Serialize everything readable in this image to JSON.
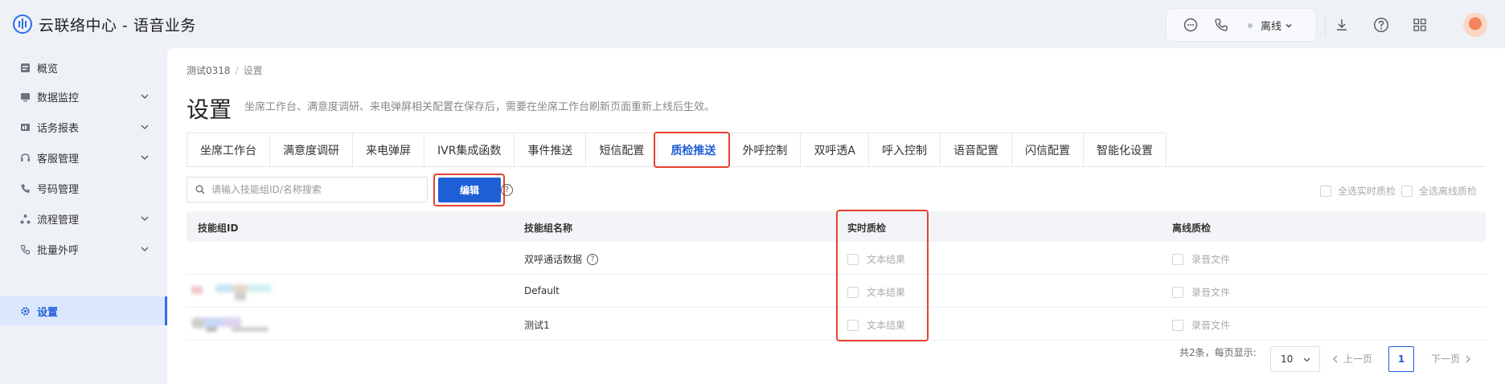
{
  "header": {
    "app_title": "云联络中心 - 语音业务",
    "status_label": "离线",
    "icons": [
      "chat-icon",
      "phone-icon",
      "download-icon",
      "help-icon",
      "grid-icon"
    ]
  },
  "sidebar": {
    "items": [
      {
        "label": "概览",
        "icon": "overview-icon",
        "expandable": false
      },
      {
        "label": "数据监控",
        "icon": "monitor-icon",
        "expandable": true
      },
      {
        "label": "话务报表",
        "icon": "report-icon",
        "expandable": true
      },
      {
        "label": "客服管理",
        "icon": "headset-icon",
        "expandable": true
      },
      {
        "label": "号码管理",
        "icon": "phone-icon",
        "expandable": false
      },
      {
        "label": "流程管理",
        "icon": "flow-icon",
        "expandable": true
      },
      {
        "label": "批量外呼",
        "icon": "phone-icon",
        "expandable": true
      },
      {
        "label": "设置",
        "icon": "gear-icon",
        "expandable": false,
        "active": true
      }
    ]
  },
  "breadcrumb": {
    "parent": "测试0318",
    "separator": "/",
    "current": "设置"
  },
  "page": {
    "title": "设置",
    "description": "坐席工作台、满意度调研、来电弹屏相关配置在保存后，需要在坐席工作台刷新页面重新上线后生效。"
  },
  "tabs": [
    "坐席工作台",
    "满意度调研",
    "来电弹屏",
    "IVR集成函数",
    "事件推送",
    "短信配置",
    "质检推送",
    "外呼控制",
    "双呼透A",
    "呼入控制",
    "语音配置",
    "闪信配置",
    "智能化设置"
  ],
  "active_tab": "质检推送",
  "toolbar": {
    "search_placeholder": "请输入技能组ID/名称搜索",
    "edit_label": "编辑",
    "help_glyph": "?",
    "select_all_realtime": "全选实时质检",
    "select_all_offline": "全选离线质检"
  },
  "table": {
    "columns": [
      "技能组ID",
      "技能组名称",
      "实时质检",
      "离线质检"
    ],
    "rows": [
      {
        "id": "",
        "id_blurred": false,
        "name": "双呼通话数据",
        "name_help": true,
        "realtime": "文本结果",
        "offline": "录音文件"
      },
      {
        "id": "",
        "id_blurred": true,
        "name": "Default",
        "name_help": false,
        "realtime": "文本结果",
        "offline": "录音文件"
      },
      {
        "id": "",
        "id_blurred": true,
        "name": "测试1",
        "name_help": false,
        "realtime": "文本结果",
        "offline": "录音文件"
      }
    ]
  },
  "pagination": {
    "total_text": "共2条，每页显示:",
    "page_size": "10",
    "prev_label": "上一页",
    "next_label": "下一页",
    "current_page": "1"
  },
  "colors": {
    "primary": "#1f5fd6",
    "highlight": "#e5412e",
    "sidebar_active_bg": "#dbe7fc"
  }
}
